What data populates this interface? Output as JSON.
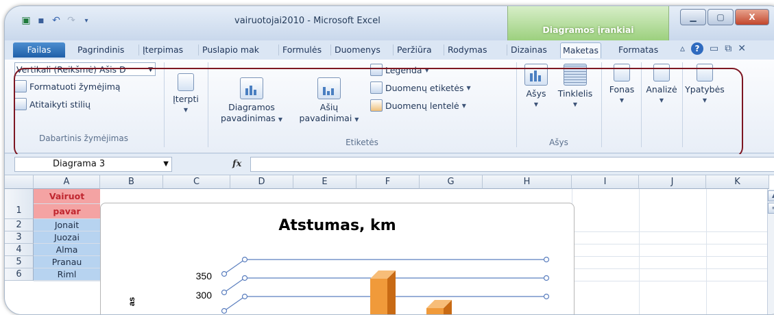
{
  "window": {
    "title": "vairuotojai2010 - Microsoft Excel",
    "context_tab_header": "Diagramos įrankiai",
    "minimize_icon": "minimize-icon",
    "maximize_icon": "maximize-icon",
    "close_label": "X"
  },
  "tabs": {
    "file": "Failas",
    "home": "Pagrindinis",
    "insert": "Įterpimas",
    "page_layout": "Puslapio mak",
    "formulas": "Formulės",
    "data": "Duomenys",
    "review": "Peržiūra",
    "view": "Rodymas",
    "design": "Dizainas",
    "layout": "Maketas",
    "format": "Formatas"
  },
  "ribbon": {
    "current_selection": {
      "combo_value": "Vertikali (Reikšmė) Ašis D",
      "format_selection": "Formatuoti žymėjimą",
      "reset_style": "Atitaikyti stilių",
      "group_label": "Dabartinis žymėjimas"
    },
    "insert": {
      "label": "Įterpti"
    },
    "labels": {
      "chart_title_line1": "Diagramos",
      "chart_title_line2": "pavadinimas",
      "axis_titles_line1": "Ašių",
      "axis_titles_line2": "pavadinimai",
      "legend": "Legenda",
      "data_labels": "Duomenų etiketės",
      "data_table": "Duomenų lentelė",
      "group_label": "Etiketės"
    },
    "axes": {
      "axes": "Ašys",
      "gridlines": "Tinklelis",
      "group_label": "Ašys"
    },
    "background": {
      "label": "Fonas"
    },
    "analysis": {
      "label": "Analizė"
    },
    "properties": {
      "label": "Ypatybės"
    }
  },
  "formula_bar": {
    "name_box": "Diagrama 3",
    "fx": "fx",
    "value": ""
  },
  "sheet": {
    "columns": [
      "A",
      "B",
      "C",
      "D",
      "E",
      "F",
      "G",
      "H",
      "I",
      "J",
      "K"
    ],
    "rows": [
      "1",
      "2",
      "3",
      "4",
      "5",
      "6"
    ],
    "cells_a": [
      "Vairuot",
      "pavar",
      "Jonait",
      "Juozai",
      "Alma",
      "Pranau",
      "Riml"
    ]
  },
  "chart": {
    "title": "Atstumas, km",
    "y_ticks": [
      "350",
      "300"
    ]
  }
}
